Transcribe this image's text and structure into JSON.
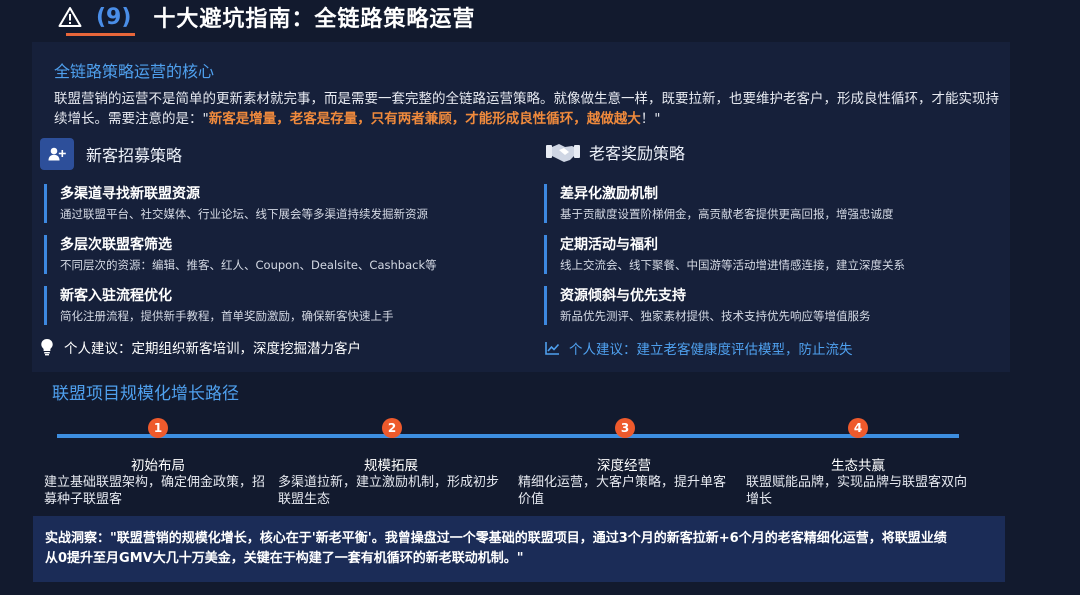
{
  "header": {
    "number": "(9)",
    "title": "十大避坑指南：全链路策略运营"
  },
  "core": {
    "title": "全链路策略运营的核心",
    "body_prefix": "联盟营销的运营不是简单的更新素材就完事，而是需要一套完整的全链路运营策略。就像做生意一样，既要拉新，也要维护老客户，形成良性循环，才能实现持续增长。需要注意的是：\"",
    "body_highlight": "新客是增量，老客是存量，只有两者兼顾，才能形成良性循环，越做越大",
    "body_suffix": "！\""
  },
  "new_customer": {
    "title": "新客招募策略",
    "items": [
      {
        "heading": "多渠道寻找新联盟资源",
        "desc": "通过联盟平台、社交媒体、行业论坛、线下展会等多渠道持续发掘新资源"
      },
      {
        "heading": "多层次联盟客筛选",
        "desc": "不同层次的资源：编辑、推客、红人、Coupon、Dealsite、Cashback等"
      },
      {
        "heading": "新客入驻流程优化",
        "desc": "简化注册流程，提供新手教程，首单奖励激励，确保新客快速上手"
      }
    ],
    "advice": "个人建议：定期组织新客培训，深度挖掘潜力客户"
  },
  "old_customer": {
    "title": "老客奖励策略",
    "items": [
      {
        "heading": "差异化激励机制",
        "desc": "基于贡献度设置阶梯佣金，高贡献老客提供更高回报，增强忠诚度"
      },
      {
        "heading": "定期活动与福利",
        "desc": "线上交流会、线下聚餐、中国游等活动增进情感连接，建立深度关系"
      },
      {
        "heading": "资源倾斜与优先支持",
        "desc": "新品优先测评、独家素材提供、技术支持优先响应等增值服务"
      }
    ],
    "advice": "个人建议：建立老客健康度评估模型，防止流失"
  },
  "growth": {
    "title": "联盟项目规模化增长路径",
    "stages": [
      {
        "num": "1",
        "name": "初始布局",
        "desc": "建立基础联盟架构，确定佣金政策，招募种子联盟客"
      },
      {
        "num": "2",
        "name": "规模拓展",
        "desc": "多渠道拉新，建立激励机制，形成初步联盟生态"
      },
      {
        "num": "3",
        "name": "深度经营",
        "desc": "精细化运营，大客户策略，提升单客价值"
      },
      {
        "num": "4",
        "name": "生态共赢",
        "desc": "联盟赋能品牌，实现品牌与联盟客双向增长"
      }
    ]
  },
  "insight": {
    "text": "实战洞察：\"联盟营销的规模化增长，核心在于'新老平衡'。我曾操盘过一个零基础的联盟项目，通过3个月的新客拉新+6个月的老客精细化运营，将联盟业绩从0提升至月GMV大几十万美金，关键在于构建了一套有机循环的新老联动机制。\""
  },
  "colors": {
    "accent_blue": "#4fa0ee",
    "highlight_orange": "#f08a3c",
    "node_orange": "#ee5a2c",
    "background": "#121a2e"
  },
  "icons": {
    "title": "warning-triangle-icon",
    "new_customer": "add-user-icon",
    "old_customer": "handshake-icon",
    "new_advice": "lightbulb-icon",
    "old_advice": "trend-chart-icon"
  }
}
